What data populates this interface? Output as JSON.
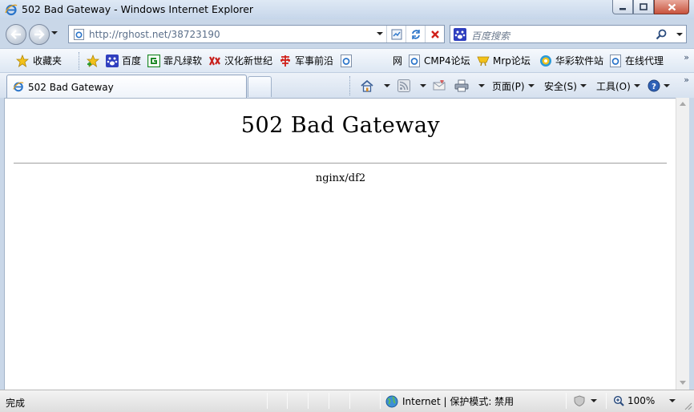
{
  "window": {
    "title": "502 Bad Gateway - Windows Internet Explorer",
    "controls": {
      "minimize": "minimize",
      "maximize": "maximize",
      "close": "close"
    }
  },
  "navigation": {
    "address_url": "http://rghost.net/38723190",
    "search_placeholder": "百度搜索"
  },
  "favorites_bar": {
    "favorites_label": "收藏夹",
    "items": [
      {
        "label": "百度",
        "icon": "paw-icon"
      },
      {
        "label": "霏凡绿软",
        "icon": "green-square-icon"
      },
      {
        "label": "汉化新世纪",
        "icon": "red-logo-icon"
      },
      {
        "label": "军事前沿",
        "icon": "hua-character-icon"
      },
      {
        "label": "网",
        "icon": "ie-page-icon"
      },
      {
        "label": "CMP4论坛",
        "icon": "ie-page-icon"
      },
      {
        "label": "Mrp论坛",
        "icon": "mrp-icon"
      },
      {
        "label": "华彩软件站",
        "icon": "swirl-icon"
      },
      {
        "label": "在线代理",
        "icon": "ie-page-icon"
      }
    ]
  },
  "tabs": [
    {
      "title": "502 Bad Gateway",
      "active": true
    }
  ],
  "command_bar": {
    "page_label": "页面(P)",
    "safety_label": "安全(S)",
    "tools_label": "工具(O)"
  },
  "page": {
    "heading": "502 Bad Gateway",
    "server": "nginx/df2"
  },
  "status_bar": {
    "status_text": "完成",
    "zone_text": "Internet | 保护模式: 禁用",
    "zoom": "100%"
  },
  "colors": {
    "chrome_blue": "#c9d7e8",
    "close_red": "#c8533d",
    "stop_red": "#d0201a"
  }
}
